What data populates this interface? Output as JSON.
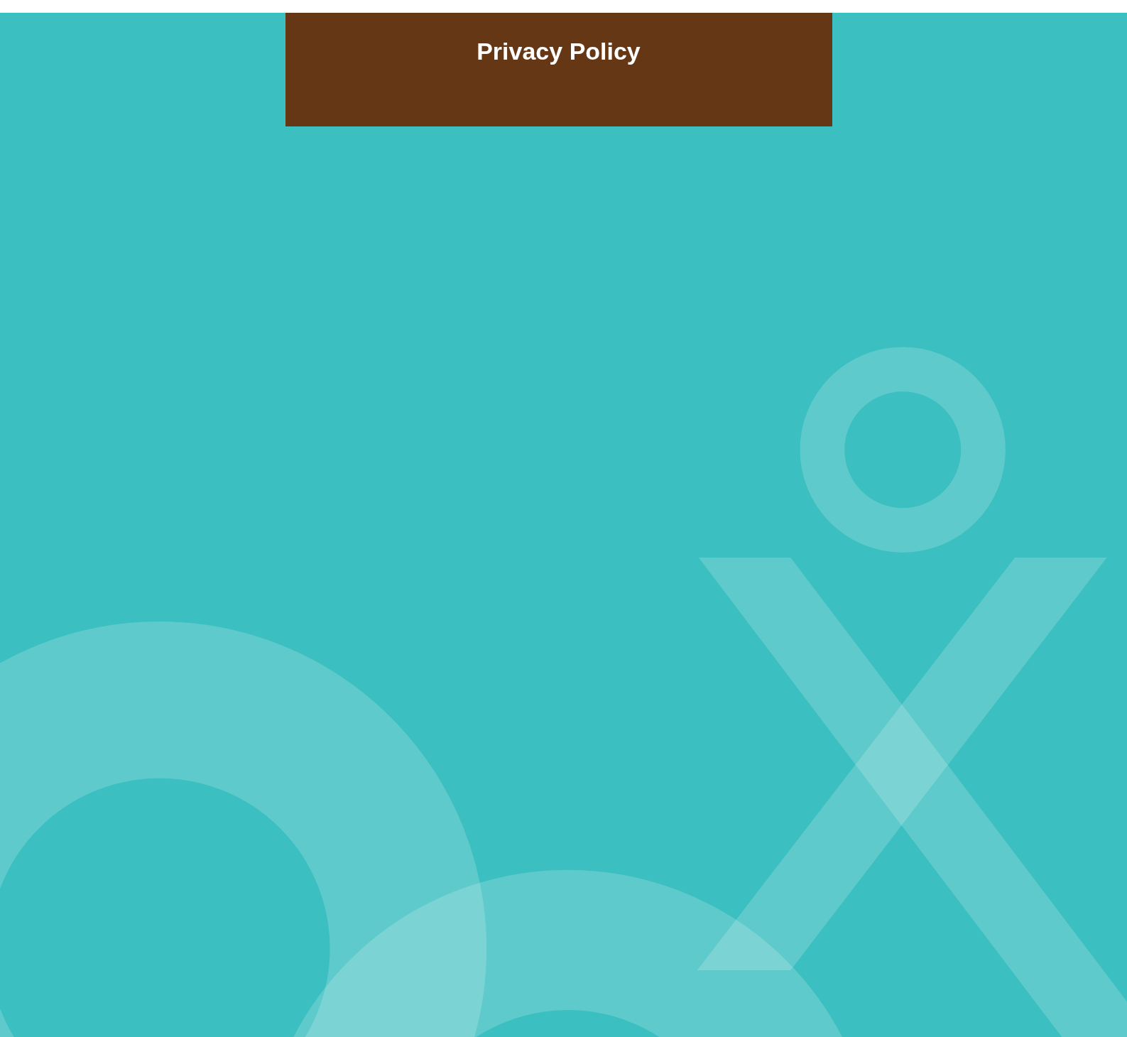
{
  "header": {
    "title": "Privacy Policy"
  }
}
